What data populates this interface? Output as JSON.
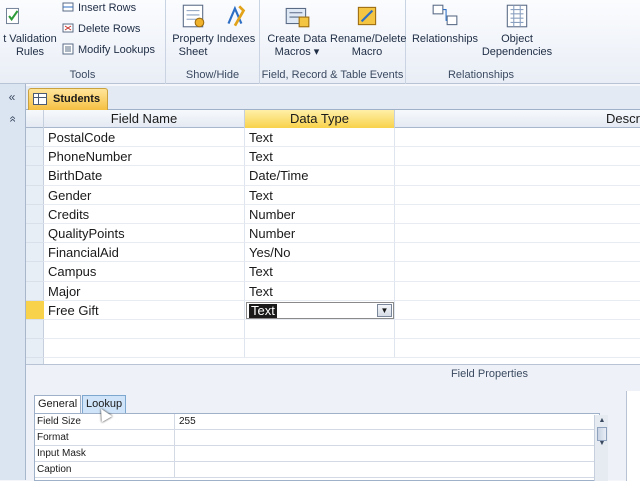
{
  "ribbon": {
    "tools": {
      "label": "Tools",
      "validation_label_1": "t Validation",
      "validation_label_2": "Rules",
      "insert_rows": "Insert Rows",
      "delete_rows": "Delete Rows",
      "modify_lookups": "Modify Lookups"
    },
    "show_hide": {
      "label": "Show/Hide",
      "property_sheet_1": "Property",
      "property_sheet_2": "Sheet",
      "indexes": "Indexes"
    },
    "events": {
      "label": "Field, Record & Table Events",
      "create_macros_1": "Create Data",
      "create_macros_2": "Macros ▾",
      "rename_delete_1": "Rename/Delete",
      "rename_delete_2": "Macro"
    },
    "relationships": {
      "label": "Relationships",
      "relationships_btn": "Relationships",
      "object_dep_1": "Object",
      "object_dep_2": "Dependencies"
    }
  },
  "nav": {
    "collapse": "«",
    "up": "»"
  },
  "document_tab": {
    "title": "Students"
  },
  "grid": {
    "headers": {
      "field_name": "Field Name",
      "data_type": "Data Type",
      "description": "Descr"
    },
    "rows": [
      {
        "name": "PostalCode",
        "type": "Text"
      },
      {
        "name": "PhoneNumber",
        "type": "Text"
      },
      {
        "name": "BirthDate",
        "type": "Date/Time"
      },
      {
        "name": "Gender",
        "type": "Text"
      },
      {
        "name": "Credits",
        "type": "Number"
      },
      {
        "name": "QualityPoints",
        "type": "Number"
      },
      {
        "name": "FinancialAid",
        "type": "Yes/No"
      },
      {
        "name": "Campus",
        "type": "Text"
      },
      {
        "name": "Major",
        "type": "Text"
      },
      {
        "name": "Free Gift",
        "type": "Text"
      }
    ]
  },
  "field_properties": {
    "title": "Field Properties",
    "tabs": {
      "general": "General",
      "lookup": "Lookup"
    },
    "rows": [
      {
        "label": "Field Size",
        "value": "255"
      },
      {
        "label": "Format",
        "value": ""
      },
      {
        "label": "Input Mask",
        "value": ""
      },
      {
        "label": "Caption",
        "value": ""
      }
    ]
  },
  "colors": {
    "accent": "#f8d24b",
    "tab_active": "#f5c043",
    "lookup_tab": "#cfe4f8"
  }
}
